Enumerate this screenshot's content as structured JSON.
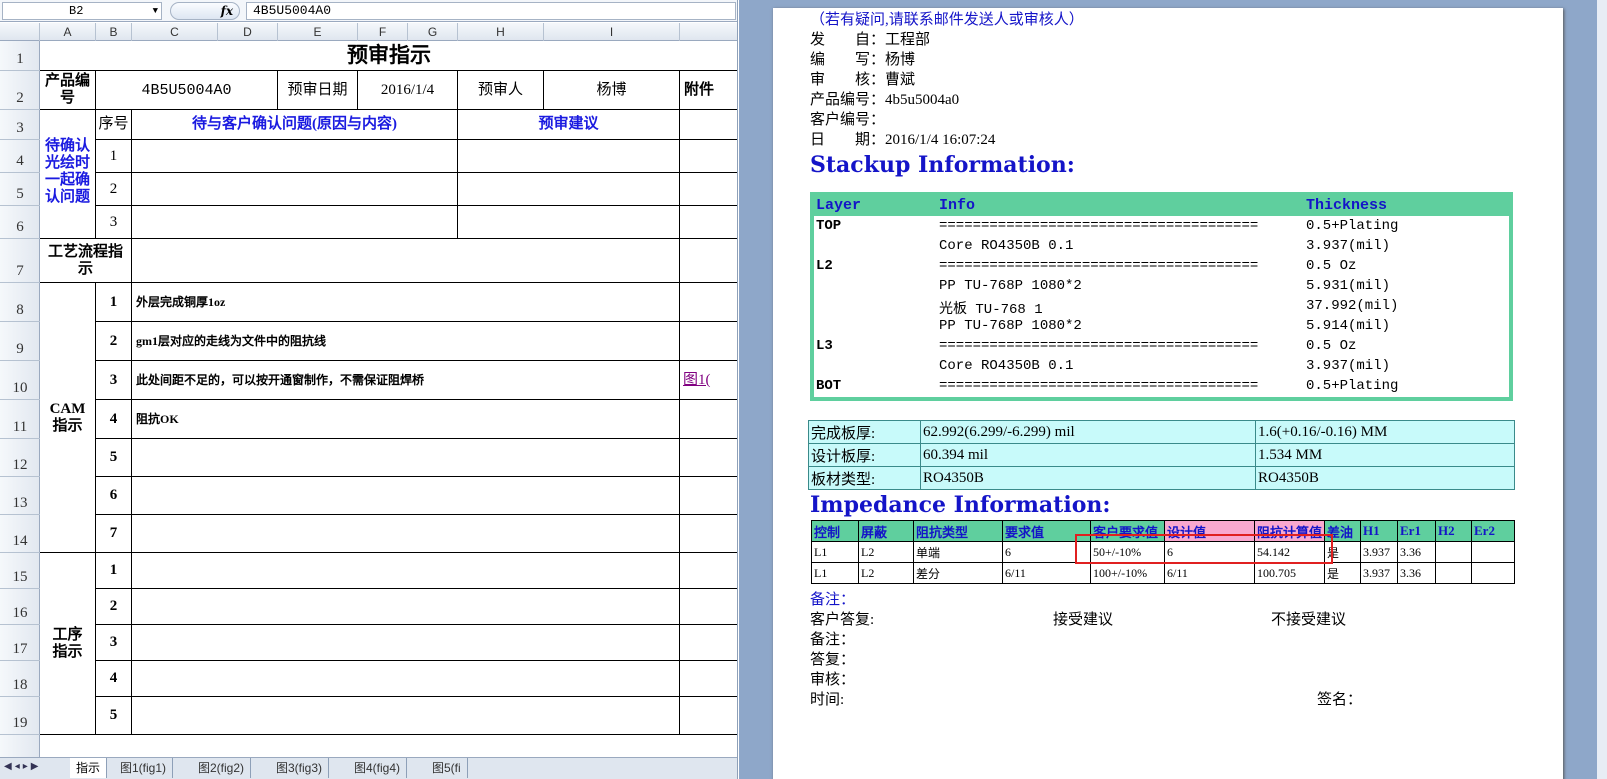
{
  "excel": {
    "name_box": "B2",
    "fx": "fx",
    "formula_value": "4B5U5004A0",
    "columns": [
      "A",
      "B",
      "C",
      "D",
      "E",
      "F",
      "G",
      "H",
      "I"
    ],
    "rows": [
      "1",
      "2",
      "3",
      "4",
      "5",
      "6",
      "7",
      "8",
      "9",
      "10",
      "11",
      "12",
      "13",
      "14",
      "15",
      "16",
      "17",
      "18",
      "19"
    ],
    "title": "预审指示",
    "product_label": "产品编号",
    "product_value": "4B5U5004A0",
    "review_date_label": "预审日期",
    "review_date_value": "2016/1/4",
    "reviewer_label": "预审人",
    "reviewer_value": "杨博",
    "attachment_label": "附件",
    "seq_label": "序号",
    "pending_issues_header": "待与客户确认问题(原因与内容)",
    "suggestion_header": "预审建议",
    "confirm_group_label": "待确认光绘时一起确认问题",
    "confirm_nums": [
      "1",
      "2",
      "3"
    ],
    "process_label": "工艺流程指示",
    "cam_label": "CAM指示",
    "cam_nums": [
      "1",
      "2",
      "3",
      "4",
      "5",
      "6",
      "7"
    ],
    "cam_items": [
      "外层完成铜厚1oz",
      "gm1层对应的走线为文件中的阻抗线",
      "此处间距不足的，可以按开通窗制作，不需保证阻焊桥",
      "阻抗OK"
    ],
    "cam_link": "图1(",
    "process2_label": "工序指示",
    "process2_nums": [
      "1",
      "2",
      "3",
      "4",
      "5"
    ],
    "sheet_tabs": [
      "指示",
      "图1(fig1)",
      "图2(fig2)",
      "图3(fig3)",
      "图4(fig4)",
      "图5(fi"
    ]
  },
  "word": {
    "note_line": "（若有疑问,请联系邮件发送人或审核人）",
    "fields": [
      {
        "label": "发　　自：",
        "value": "工程部"
      },
      {
        "label": "编　　写：",
        "value": "杨博"
      },
      {
        "label": "审　　核：",
        "value": "曹斌"
      },
      {
        "label": "产品编号：",
        "value": "4b5u5004a0"
      },
      {
        "label": "客户编号：",
        "value": ""
      },
      {
        "label": "日　　期：",
        "value": "2016/1/4 16:07:24"
      }
    ],
    "stackup_heading": "Stackup Information:",
    "stackup_headers": [
      "Layer",
      "Info",
      "Thickness"
    ],
    "stackup_rows": [
      {
        "layer": "TOP",
        "info": "======================================",
        "thickness": "0.5+Plating"
      },
      {
        "layer": "",
        "info": "Core    RO4350B    0.1",
        "thickness": "3.937(mil)"
      },
      {
        "layer": "L2",
        "info": "======================================",
        "thickness": "0.5 Oz"
      },
      {
        "layer": "",
        "info": "PP    TU-768P    1080*2",
        "thickness": "5.931(mil)"
      },
      {
        "layer": "",
        "info": "光板     TU-768     1",
        "thickness": "37.992(mil)"
      },
      {
        "layer": "",
        "info": "PP    TU-768P    1080*2",
        "thickness": "5.914(mil)"
      },
      {
        "layer": "L3",
        "info": "======================================",
        "thickness": "0.5 Oz"
      },
      {
        "layer": "",
        "info": "Core    RO4350B    0.1",
        "thickness": "3.937(mil)"
      },
      {
        "layer": "BOT",
        "info": "======================================",
        "thickness": "0.5+Plating"
      }
    ],
    "board_rows": [
      [
        "完成板厚:",
        "62.992(6.299/-6.299) mil",
        "1.6(+0.16/-0.16) MM"
      ],
      [
        "设计板厚:",
        "60.394 mil",
        "1.534 MM"
      ],
      [
        "板材类型:",
        "RO4350B",
        "RO4350B"
      ]
    ],
    "impedance_heading": "Impedance Information:",
    "impedance_headers": [
      "控制",
      "屏蔽",
      "阻抗类型",
      "要求值",
      "客户要求值",
      "设计值",
      "阻抗计算值",
      "差油",
      "H1",
      "Er1",
      "H2",
      "Er2"
    ],
    "impedance_rows": [
      [
        "L1",
        "L2",
        "单端",
        "6",
        "50+/-10%",
        "6",
        "54.142",
        "是",
        "3.937",
        "3.36",
        "",
        ""
      ],
      [
        "L1",
        "L2",
        "差分",
        "6/11",
        "100+/-10%",
        "6/11",
        "100.705",
        "是",
        "3.937",
        "3.36",
        "",
        ""
      ]
    ],
    "remark_label": "备注：",
    "customer_reply_label": "客户答复:",
    "accept_label": "接受建议",
    "reject_label": "不接受建议",
    "remark2_label": "备注：",
    "reply_label": "答复：",
    "review_label": "审核：",
    "time_label": "时间:",
    "sign_label": "签名："
  }
}
